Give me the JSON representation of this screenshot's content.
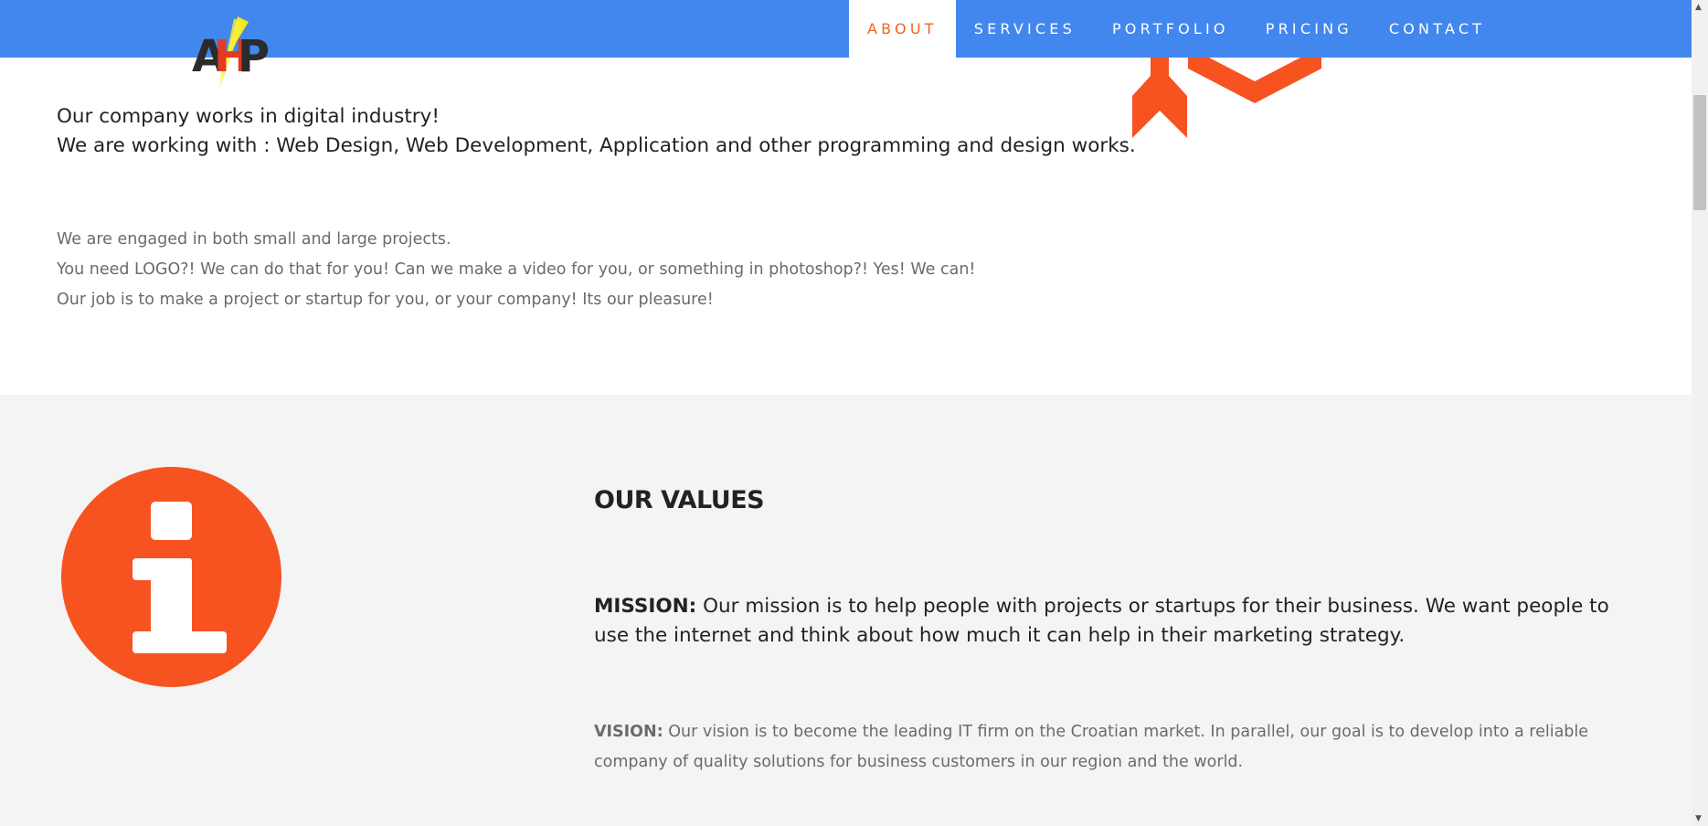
{
  "nav": {
    "items": [
      {
        "label": "ABOUT",
        "active": true
      },
      {
        "label": "SERVICES",
        "active": false
      },
      {
        "label": "PORTFOLIO",
        "active": false
      },
      {
        "label": "PRICING",
        "active": false
      },
      {
        "label": "CONTACT",
        "active": false
      }
    ]
  },
  "logo": {
    "text": "AHP"
  },
  "languages": [
    {
      "name": "uk-flag-icon"
    },
    {
      "name": "germany-flag-icon"
    }
  ],
  "intro": {
    "headline_1": "Our company works in digital industry!",
    "headline_2": "We are working with : Web Design, Web Development, Application and other programming and design works.",
    "paragraph": [
      "We are engaged in both small and large projects.",
      "You need LOGO?! We can do that for you! Can we make a video for you, or something in photoshop?! Yes! We can!",
      "Our job is to make a project or startup for you, or your company! Its our pleasure!"
    ]
  },
  "values": {
    "title": "OUR VALUES",
    "mission_label": "MISSION:",
    "mission_text": " Our mission is to help people with projects or startups for their business. We want people to use the internet and think about how much it can help in their marketing strategy.",
    "vision_label": "VISION:",
    "vision_text": " Our vision is to become the leading IT firm on the Croatian market. In parallel, our goal is to develop into a reliable company of quality solutions for business customers in our region and the world."
  },
  "colors": {
    "topbar": "#4287ee",
    "accent": "#f0641e",
    "icon_orange": "#f65320",
    "section_bg": "#f4f4f4"
  }
}
